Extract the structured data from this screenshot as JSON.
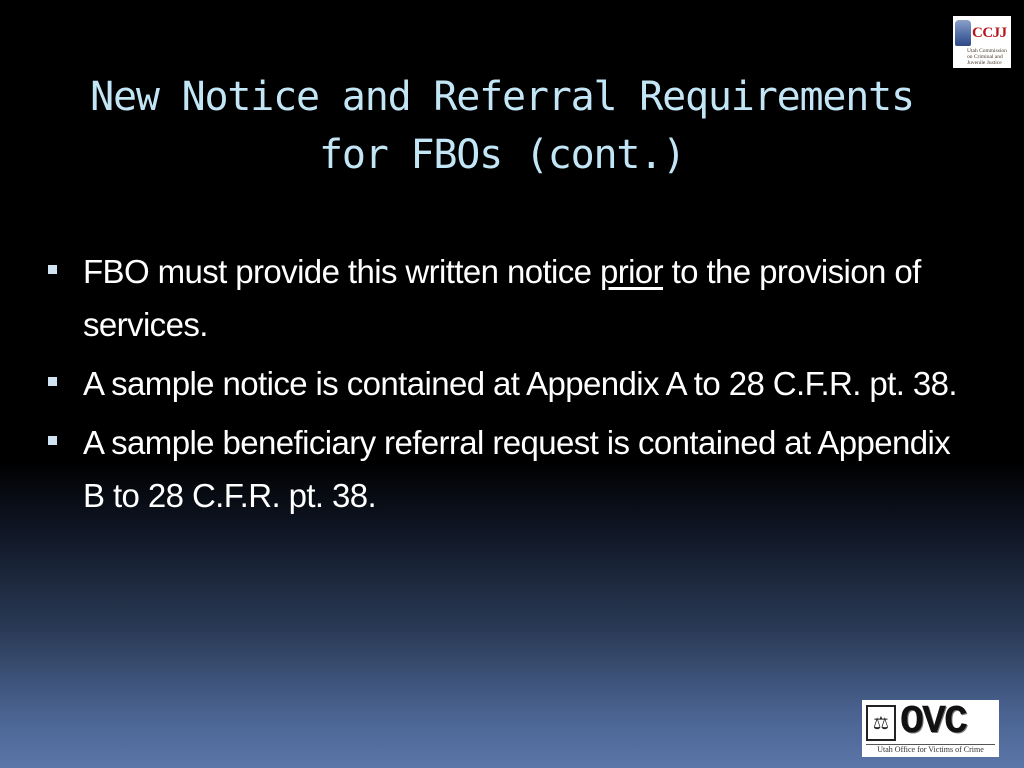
{
  "slide": {
    "title_line1": "New Notice and Referral Requirements",
    "title_line2": "for FBOs (cont.)",
    "bullets": [
      {
        "before": "FBO must provide this written notice ",
        "emphasis": "prior",
        "after": " to the provision of services."
      },
      {
        "text": "A sample notice is contained at Appendix A to 28 C.F.R. pt. 38."
      },
      {
        "text": "A sample beneficiary referral request is contained at Appendix B to 28 C.F.R. pt. 38."
      }
    ]
  },
  "logos": {
    "top_right": {
      "icon": "ccjj-logo-icon",
      "wordmark": "CCJJ",
      "subtitle_line1": "Utah Commission",
      "subtitle_line2": "on Criminal and",
      "subtitle_line3": "Juvenile Justice"
    },
    "bottom_right": {
      "icon": "ovc-logo-icon",
      "scales_glyph": "⚖",
      "wordmark": "OVC",
      "subtitle": "Utah Office for Victims of Crime"
    }
  },
  "colors": {
    "title": "#c3e6f7",
    "body_text": "#ffffff",
    "bullet": "#cfe3f3",
    "ccjj_red": "#b3151d",
    "background_top": "#000000",
    "background_bottom": "#5a76a8"
  }
}
